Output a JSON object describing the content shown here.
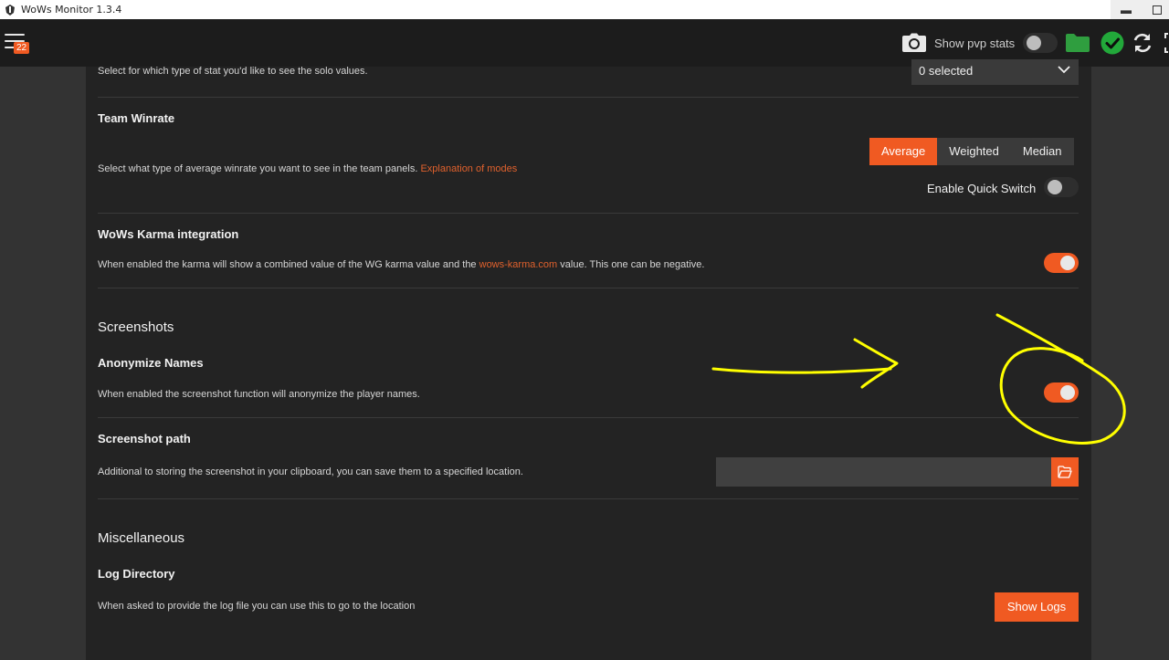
{
  "window": {
    "title": "WoWs Monitor 1.3.4",
    "minimize": "▬"
  },
  "topbar": {
    "notification_count": "22",
    "show_pvp_label": "Show pvp stats",
    "show_pvp_on": false,
    "icons": [
      "menu-icon",
      "camera-icon",
      "folder-icon",
      "check-icon",
      "refresh-icon"
    ]
  },
  "solo": {
    "description": "Select for which type of stat you'd like to see the solo values.",
    "select_value": "0 selected"
  },
  "team_winrate": {
    "title": "Team Winrate",
    "description": "Select what type of average winrate you want to see in the team panels.",
    "link": "Explanation of modes",
    "modes": [
      "Average",
      "Weighted",
      "Median"
    ],
    "active_mode": "Average",
    "quick_switch_label": "Enable Quick Switch",
    "quick_switch_on": false
  },
  "karma": {
    "title": "WoWs Karma integration",
    "desc_before": "When enabled the karma will show a combined value of the WG karma value and the",
    "link": "wows-karma.com",
    "desc_after": "value. This one can be negative.",
    "enabled": true
  },
  "screenshots": {
    "section": "Screenshots",
    "anonymize_title": "Anonymize Names",
    "anonymize_desc": "When enabled the screenshot function will anonymize the player names.",
    "anonymize_on": true,
    "path_title": "Screenshot path",
    "path_desc": "Additional to storing the screenshot in your clipboard, you can save them to a specified location.",
    "path_value": ""
  },
  "misc": {
    "section": "Miscellaneous",
    "log_title": "Log Directory",
    "log_desc": "When asked to provide the log file you can use this to go to the location",
    "log_button": "Show Logs"
  },
  "colors": {
    "accent": "#f05a22",
    "ok_green": "#22a83a",
    "folder_green": "#2f9e3f",
    "annotation": "#ffff00"
  }
}
